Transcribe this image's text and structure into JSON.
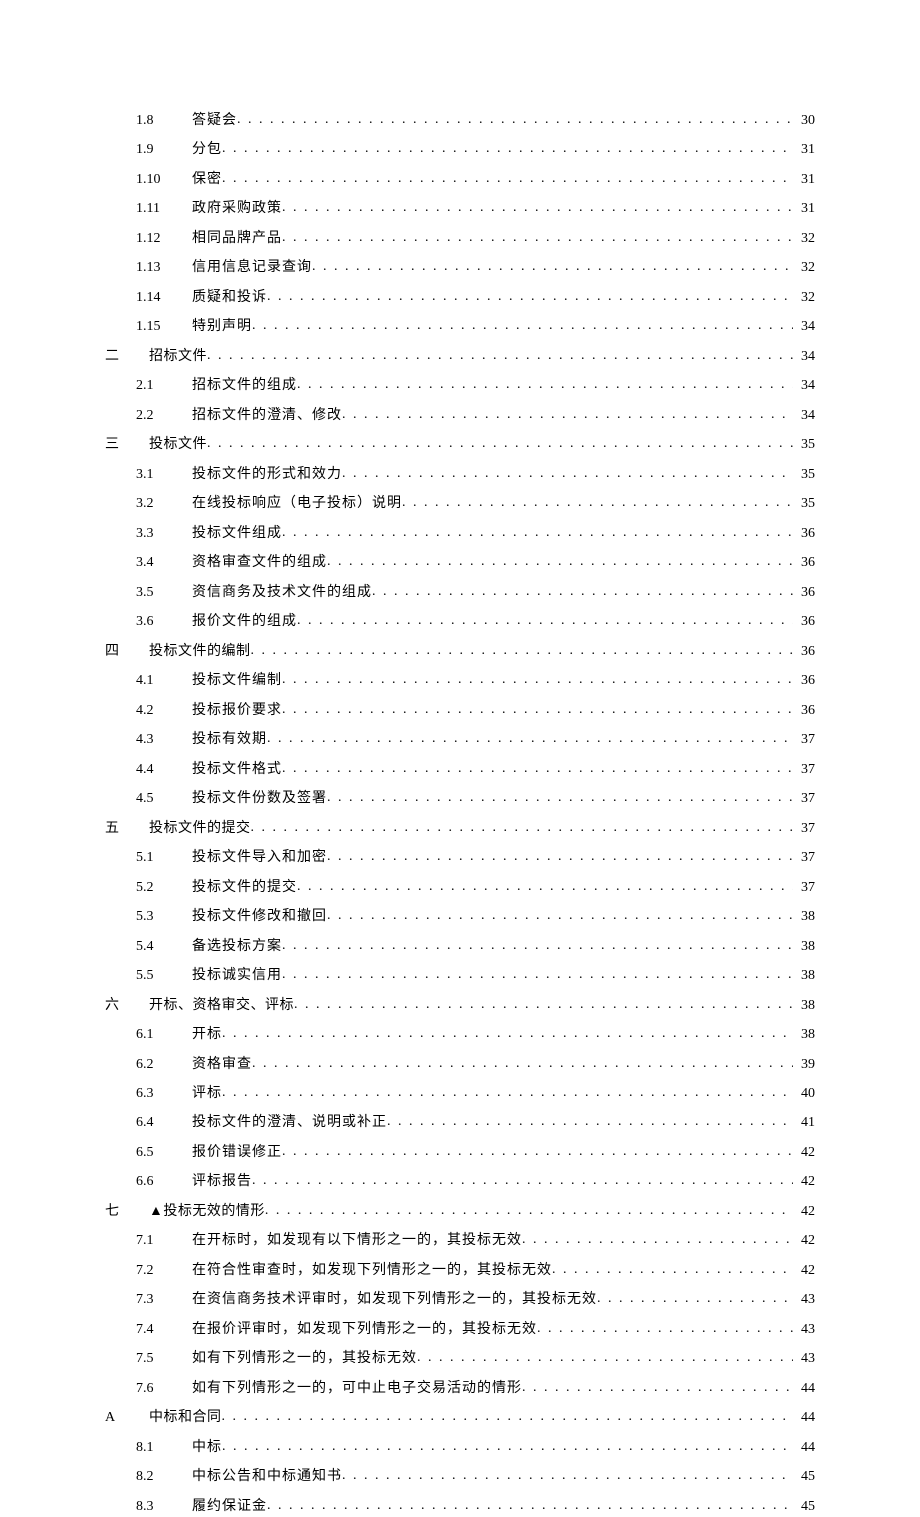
{
  "toc": [
    {
      "level": 1,
      "num": "1.8",
      "title": "答疑会",
      "page": "30"
    },
    {
      "level": 1,
      "num": "1.9",
      "title": "分包",
      "page": "31"
    },
    {
      "level": 1,
      "num": "1.10",
      "title": "保密",
      "page": "31"
    },
    {
      "level": 1,
      "num": "1.11",
      "title": "政府采购政策",
      "page": "31"
    },
    {
      "level": 1,
      "num": "1.12",
      "title": "相同品牌产品",
      "page": "32"
    },
    {
      "level": 1,
      "num": "1.13",
      "title": "信用信息记录查询",
      "page": "32"
    },
    {
      "level": 1,
      "num": "1.14",
      "title": "质疑和投诉",
      "page": "32"
    },
    {
      "level": 1,
      "num": "1.15",
      "title": "特别声明",
      "page": "34"
    },
    {
      "level": 0,
      "num": "二",
      "title": "招标文件",
      "page": "34"
    },
    {
      "level": 1,
      "num": "2.1",
      "title": "招标文件的组成",
      "page": "34"
    },
    {
      "level": 1,
      "num": "2.2",
      "title": "招标文件的澄清、修改",
      "page": "34"
    },
    {
      "level": 0,
      "num": "三",
      "title": "投标文件",
      "page": "35"
    },
    {
      "level": 1,
      "num": "3.1",
      "title": "投标文件的形式和效力",
      "page": "35"
    },
    {
      "level": 1,
      "num": "3.2",
      "title": "在线投标响应（电子投标）说明",
      "page": "35"
    },
    {
      "level": 1,
      "num": "3.3",
      "title": "投标文件组成",
      "page": "36"
    },
    {
      "level": 1,
      "num": "3.4",
      "title": "资格审查文件的组成",
      "page": "36"
    },
    {
      "level": 1,
      "num": "3.5",
      "title": "资信商务及技术文件的组成",
      "page": "36"
    },
    {
      "level": 1,
      "num": "3.6",
      "title": "报价文件的组成",
      "page": "36"
    },
    {
      "level": 0,
      "num": "四",
      "title": "投标文件的编制",
      "page": "36"
    },
    {
      "level": 1,
      "num": "4.1",
      "title": "投标文件编制",
      "page": "36"
    },
    {
      "level": 1,
      "num": "4.2",
      "title": "投标报价要求",
      "page": "36"
    },
    {
      "level": 1,
      "num": "4.3",
      "title": "投标有效期",
      "page": "37"
    },
    {
      "level": 1,
      "num": "4.4",
      "title": "投标文件格式",
      "page": "37"
    },
    {
      "level": 1,
      "num": "4.5",
      "title": "投标文件份数及签署",
      "page": "37"
    },
    {
      "level": 0,
      "num": "五",
      "title": "投标文件的提交",
      "page": "37"
    },
    {
      "level": 1,
      "num": "5.1",
      "title": "投标文件导入和加密",
      "page": "37"
    },
    {
      "level": 1,
      "num": "5.2",
      "title": "投标文件的提交",
      "page": "37"
    },
    {
      "level": 1,
      "num": "5.3",
      "title": "投标文件修改和撤回",
      "page": "38"
    },
    {
      "level": 1,
      "num": "5.4",
      "title": "备选投标方案",
      "page": "38"
    },
    {
      "level": 1,
      "num": "5.5",
      "title": "投标诚实信用",
      "page": "38"
    },
    {
      "level": 0,
      "num": "六",
      "title": "开标、资格审交、评标",
      "page": "38"
    },
    {
      "level": 1,
      "num": "6.1",
      "title": "开标",
      "page": "38"
    },
    {
      "level": 1,
      "num": "6.2",
      "title": "资格审查",
      "page": "39"
    },
    {
      "level": 1,
      "num": "6.3",
      "title": "评标",
      "page": "40"
    },
    {
      "level": 1,
      "num": "6.4",
      "title": "投标文件的澄清、说明或补正",
      "page": "41"
    },
    {
      "level": 1,
      "num": "6.5",
      "title": "报价错误修正",
      "page": "42"
    },
    {
      "level": 1,
      "num": "6.6",
      "title": "评标报告",
      "page": "42"
    },
    {
      "level": 0,
      "num": "七",
      "title": "▲投标无效的情形",
      "page": "42"
    },
    {
      "level": 1,
      "num": "7.1",
      "title": "在开标时，如发现有以下情形之一的，其投标无效",
      "page": "42"
    },
    {
      "level": 1,
      "num": "7.2",
      "title": "在符合性审查时，如发现下列情形之一的，其投标无效",
      "page": "42"
    },
    {
      "level": 1,
      "num": "7.3",
      "title": "在资信商务技术评审时，如发现下列情形之一的，其投标无效",
      "page": "43"
    },
    {
      "level": 1,
      "num": "7.4",
      "title": "在报价评审时，如发现下列情形之一的，其投标无效",
      "page": "43"
    },
    {
      "level": 1,
      "num": "7.5",
      "title": "如有下列情形之一的，其投标无效",
      "page": "43"
    },
    {
      "level": 1,
      "num": "7.6",
      "title": "如有下列情形之一的，可中止电子交易活动的情形",
      "page": "44"
    },
    {
      "level": 0,
      "num": "A",
      "title": "中标和合同",
      "page": "44"
    },
    {
      "level": 1,
      "num": "8.1",
      "title": "中标",
      "page": "44"
    },
    {
      "level": 1,
      "num": "8.2",
      "title": "中标公告和中标通知书",
      "page": "45"
    },
    {
      "level": 1,
      "num": "8.3",
      "title": "履约保证金",
      "page": "45"
    }
  ]
}
